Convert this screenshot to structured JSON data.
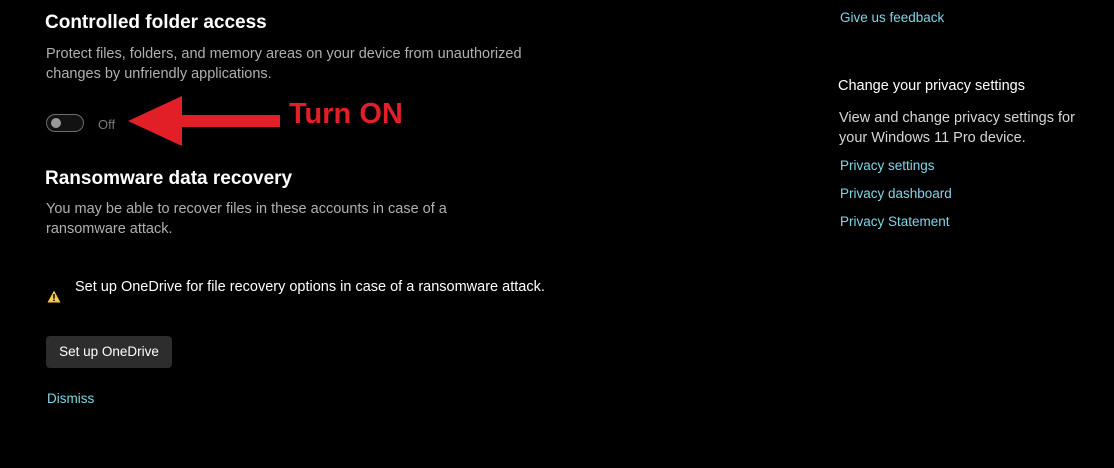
{
  "controlled_folder_access": {
    "title": "Controlled folder access",
    "description": "Protect files, folders, and memory areas on your device from unauthorized changes by unfriendly applications.",
    "toggle_state": "Off"
  },
  "annotation": {
    "text": "Turn ON",
    "color": "#e21f26"
  },
  "ransomware_recovery": {
    "title": "Ransomware data recovery",
    "description": "You may be able to recover files in these accounts in case of a ransomware attack.",
    "warning_text": "Set up OneDrive for file recovery options in case of a ransomware attack.",
    "setup_button": "Set up OneDrive",
    "dismiss_link": "Dismiss"
  },
  "sidebar": {
    "feedback_link": "Give us feedback",
    "privacy_title": "Change your privacy settings",
    "privacy_description": "View and change privacy settings for your Windows 11 Pro device.",
    "links": [
      "Privacy settings",
      "Privacy dashboard",
      "Privacy Statement"
    ]
  },
  "colors": {
    "background": "#000000",
    "link": "#7fd6e6",
    "warning": "#f2c94c"
  }
}
